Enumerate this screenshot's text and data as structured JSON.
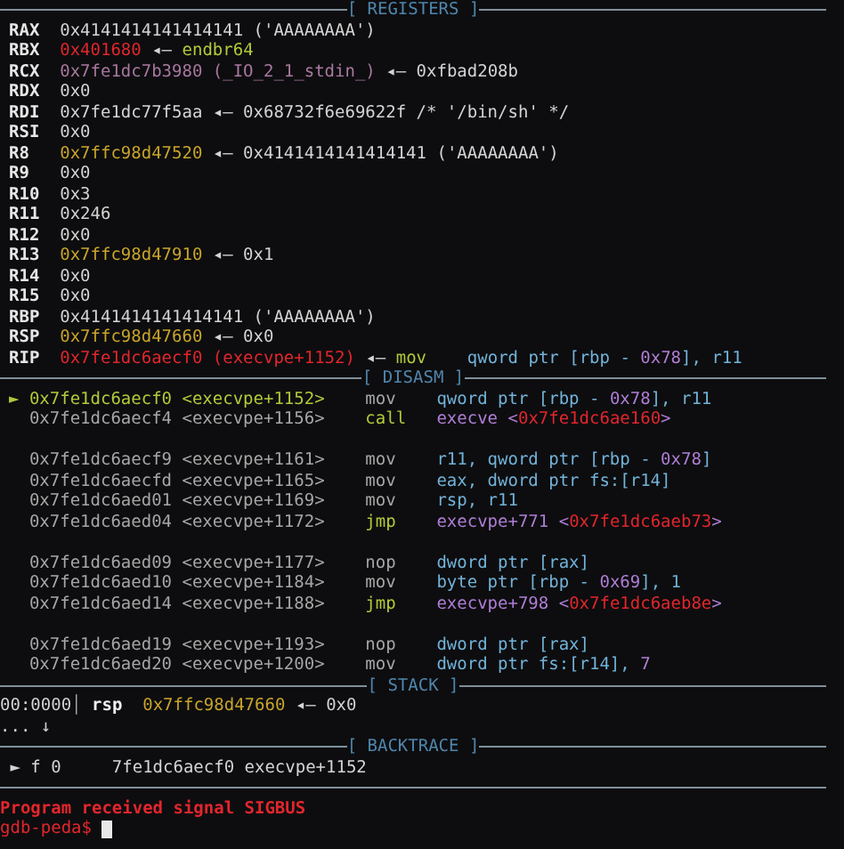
{
  "registers": {
    "title": "[ REGISTERS ]",
    "rows": [
      {
        "name": "RAX",
        "value": [
          {
            "text": "0x4141414141414141 ('AAAAAAAA')",
            "kind": "plain"
          }
        ]
      },
      {
        "name": "RBX",
        "value": [
          {
            "text": "0x401680",
            "kind": "code"
          },
          {
            "text": " ◂— ",
            "kind": "plain"
          },
          {
            "text": "endbr64",
            "kind": "instr"
          }
        ]
      },
      {
        "name": "RCX",
        "value": [
          {
            "text": "0x7fe1dc7b3980 (_IO_2_1_stdin_)",
            "kind": "libc"
          },
          {
            "text": " ◂— 0xfbad208b",
            "kind": "plain"
          }
        ]
      },
      {
        "name": "RDX",
        "value": [
          {
            "text": "0x0",
            "kind": "plain"
          }
        ]
      },
      {
        "name": "RDI",
        "value": [
          {
            "text": "0x7fe1dc77f5aa ◂— 0x68732f6e69622f /* '/bin/sh' */",
            "kind": "plain"
          }
        ]
      },
      {
        "name": "RSI",
        "value": [
          {
            "text": "0x0",
            "kind": "plain"
          }
        ]
      },
      {
        "name": "R8",
        "value": [
          {
            "text": "0x7ffc98d47520",
            "kind": "stack"
          },
          {
            "text": " ◂— 0x4141414141414141 ('AAAAAAAA')",
            "kind": "plain"
          }
        ]
      },
      {
        "name": "R9",
        "value": [
          {
            "text": "0x0",
            "kind": "plain"
          }
        ]
      },
      {
        "name": "R10",
        "value": [
          {
            "text": "0x3",
            "kind": "plain"
          }
        ]
      },
      {
        "name": "R11",
        "value": [
          {
            "text": "0x246",
            "kind": "plain"
          }
        ]
      },
      {
        "name": "R12",
        "value": [
          {
            "text": "0x0",
            "kind": "plain"
          }
        ]
      },
      {
        "name": "R13",
        "value": [
          {
            "text": "0x7ffc98d47910",
            "kind": "stack"
          },
          {
            "text": " ◂— 0x1",
            "kind": "plain"
          }
        ]
      },
      {
        "name": "R14",
        "value": [
          {
            "text": "0x0",
            "kind": "plain"
          }
        ]
      },
      {
        "name": "R15",
        "value": [
          {
            "text": "0x0",
            "kind": "plain"
          }
        ]
      },
      {
        "name": "RBP",
        "value": [
          {
            "text": "0x4141414141414141 ('AAAAAAAA')",
            "kind": "plain"
          }
        ]
      },
      {
        "name": "RSP",
        "value": [
          {
            "text": "0x7ffc98d47660",
            "kind": "stack"
          },
          {
            "text": " ◂— 0x0",
            "kind": "plain"
          }
        ]
      },
      {
        "name": "RIP",
        "value": [
          {
            "text": "0x7fe1dc6aecf0 (execvpe+1152)",
            "kind": "code"
          },
          {
            "text": " ◂— ",
            "kind": "plain"
          },
          {
            "text": "mov    ",
            "kind": "instr"
          },
          {
            "text": "qword ptr [rbp - ",
            "kind": "operand"
          },
          {
            "text": "0x78",
            "kind": "number"
          },
          {
            "text": "], r11",
            "kind": "operand"
          }
        ]
      }
    ]
  },
  "disasm": {
    "title": "[ DISASM ]",
    "groups": [
      [
        {
          "marker": "►",
          "current": true,
          "address": "0x7fe1dc6aecf0 <execvpe+1152>",
          "mnemonic": {
            "text": "mov",
            "kind": "dim"
          },
          "operands": [
            {
              "text": "qword ptr [rbp - ",
              "kind": "operand"
            },
            {
              "text": "0x78",
              "kind": "number"
            },
            {
              "text": "], r11",
              "kind": "operand"
            }
          ]
        },
        {
          "current": false,
          "address": "0x7fe1dc6aecf4 <execvpe+1156>",
          "mnemonic": {
            "text": "call",
            "kind": "instr"
          },
          "operands": [
            {
              "text": "execve <",
              "kind": "number"
            },
            {
              "text": "0x7fe1dc6ae160",
              "kind": "code"
            },
            {
              "text": ">",
              "kind": "number"
            }
          ]
        }
      ],
      [
        {
          "current": false,
          "address": "0x7fe1dc6aecf9 <execvpe+1161>",
          "mnemonic": {
            "text": "mov",
            "kind": "dim"
          },
          "operands": [
            {
              "text": "r11, qword ptr [rbp - ",
              "kind": "operand"
            },
            {
              "text": "0x78",
              "kind": "number"
            },
            {
              "text": "]",
              "kind": "operand"
            }
          ]
        },
        {
          "current": false,
          "address": "0x7fe1dc6aecfd <execvpe+1165>",
          "mnemonic": {
            "text": "mov",
            "kind": "dim"
          },
          "operands": [
            {
              "text": "eax, dword ptr fs:[r14]",
              "kind": "operand"
            }
          ]
        },
        {
          "current": false,
          "address": "0x7fe1dc6aed01 <execvpe+1169>",
          "mnemonic": {
            "text": "mov",
            "kind": "dim"
          },
          "operands": [
            {
              "text": "rsp, r11",
              "kind": "operand"
            }
          ]
        },
        {
          "current": false,
          "address": "0x7fe1dc6aed04 <execvpe+1172>",
          "mnemonic": {
            "text": "jmp",
            "kind": "instr"
          },
          "operands": [
            {
              "text": "execvpe+771 <",
              "kind": "number"
            },
            {
              "text": "0x7fe1dc6aeb73",
              "kind": "code"
            },
            {
              "text": ">",
              "kind": "number"
            }
          ]
        }
      ],
      [
        {
          "current": false,
          "address": "0x7fe1dc6aed09 <execvpe+1177>",
          "mnemonic": {
            "text": "nop",
            "kind": "dim"
          },
          "operands": [
            {
              "text": "dword ptr [rax]",
              "kind": "operand"
            }
          ]
        },
        {
          "current": false,
          "address": "0x7fe1dc6aed10 <execvpe+1184>",
          "mnemonic": {
            "text": "mov",
            "kind": "dim"
          },
          "operands": [
            {
              "text": "byte ptr [rbp - ",
              "kind": "operand"
            },
            {
              "text": "0x69",
              "kind": "number"
            },
            {
              "text": "], 1",
              "kind": "operand"
            }
          ]
        },
        {
          "current": false,
          "address": "0x7fe1dc6aed14 <execvpe+1188>",
          "mnemonic": {
            "text": "jmp",
            "kind": "instr"
          },
          "operands": [
            {
              "text": "execvpe+798 <",
              "kind": "number"
            },
            {
              "text": "0x7fe1dc6aeb8e",
              "kind": "code"
            },
            {
              "text": ">",
              "kind": "number"
            }
          ]
        }
      ],
      [
        {
          "current": false,
          "address": "0x7fe1dc6aed19 <execvpe+1193>",
          "mnemonic": {
            "text": "nop",
            "kind": "dim"
          },
          "operands": [
            {
              "text": "dword ptr [rax]",
              "kind": "operand"
            }
          ]
        },
        {
          "current": false,
          "address": "0x7fe1dc6aed20 <execvpe+1200>",
          "mnemonic": {
            "text": "mov",
            "kind": "dim"
          },
          "operands": [
            {
              "text": "dword ptr fs:[r14], ",
              "kind": "operand"
            },
            {
              "text": "7",
              "kind": "number"
            }
          ]
        }
      ]
    ]
  },
  "stack": {
    "title": "[ STACK ]",
    "lines": [
      [
        {
          "text": "00:0000",
          "kind": "plain"
        },
        {
          "text": "│",
          "kind": "dim"
        },
        {
          "text": " rsp  ",
          "kind": "reg"
        },
        {
          "text": "0x7ffc98d47660",
          "kind": "stack"
        },
        {
          "text": " ◂— 0x0",
          "kind": "plain"
        }
      ],
      [
        {
          "text": "... ↓",
          "kind": "plain"
        }
      ]
    ]
  },
  "backtrace": {
    "title": "[ BACKTRACE ]",
    "frames": [
      [
        {
          "text": " ► f 0     7fe1dc6aecf0 execvpe+1152",
          "kind": "plain"
        }
      ]
    ]
  },
  "signal_message": "Program received signal SIGBUS",
  "prompt": "gdb-peda$ "
}
